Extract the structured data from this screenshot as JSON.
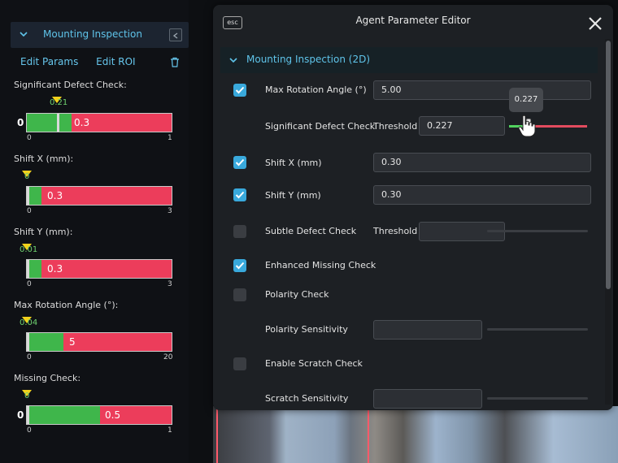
{
  "left_panel": {
    "header_title": "Mounting Inspection",
    "links": {
      "edit_params": "Edit Params",
      "edit_roi": "Edit ROI"
    },
    "metrics": [
      {
        "label": "Significant Defect Check:",
        "marker_value": "0.21",
        "bar_value": "0.3",
        "zero_label": "0",
        "min": "0",
        "max": "1",
        "fill_fraction": 0.21
      },
      {
        "label": "Shift X (mm):",
        "marker_value": "0",
        "bar_value": "0.3",
        "zero_label": "",
        "min": "0",
        "max": "3",
        "fill_fraction": 0.1
      },
      {
        "label": "Shift Y (mm):",
        "marker_value": "0.01",
        "bar_value": "0.3",
        "zero_label": "",
        "min": "0",
        "max": "3",
        "fill_fraction": 0.003
      },
      {
        "label": "Max Rotation Angle (°):",
        "marker_value": "0.04",
        "bar_value": "5",
        "zero_label": "",
        "min": "0",
        "max": "20",
        "fill_fraction": 0.25
      },
      {
        "label": "Missing Check:",
        "marker_value": "0",
        "bar_value": "0.5",
        "zero_label": "0",
        "min": "0",
        "max": "1",
        "fill_fraction": 0.5
      }
    ]
  },
  "dialog": {
    "esc_label": "esc",
    "title": "Agent Parameter Editor",
    "section_title": "Mounting Inspection (2D)",
    "rows": {
      "max_rotation": {
        "label": "Max Rotation Angle (°)",
        "checked": true,
        "value": "5.00"
      },
      "significant_defect": {
        "label": "Significant Defect Check",
        "threshold_label": "Threshold",
        "value": "0.227",
        "tooltip": "0.227",
        "slider_fraction": 0.227
      },
      "shift_x": {
        "label": "Shift X (mm)",
        "checked": true,
        "value": "0.30"
      },
      "shift_y": {
        "label": "Shift Y (mm)",
        "checked": true,
        "value": "0.30"
      },
      "subtle_defect": {
        "label": "Subtle Defect Check",
        "checked": false,
        "threshold_label": "Threshold",
        "value": ""
      },
      "enhanced_missing": {
        "label": "Enhanced Missing Check",
        "checked": true
      },
      "polarity": {
        "label": "Polarity Check",
        "checked": false
      },
      "polarity_sensitivity": {
        "label": "Polarity Sensitivity",
        "value": ""
      },
      "scratch": {
        "label": "Enable Scratch Check",
        "checked": false
      },
      "scratch_sensitivity": {
        "label": "Scratch Sensitivity",
        "value": ""
      }
    }
  },
  "colors": {
    "accent": "#5fc4ea",
    "bar_green": "#3fb64b",
    "bar_red": "#ec3d5b",
    "marker": "#f2d21c",
    "checkbox_on": "#39a9dc"
  }
}
